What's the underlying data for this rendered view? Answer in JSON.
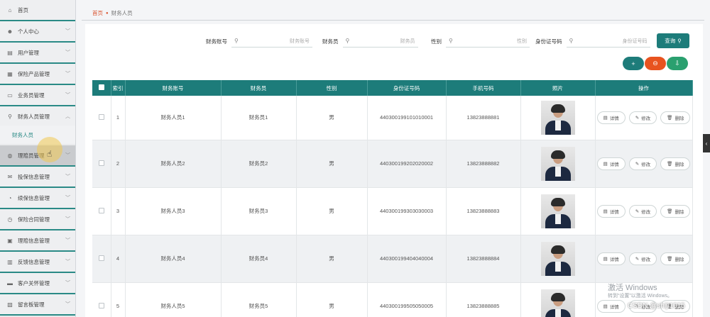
{
  "sidebar": {
    "items": [
      {
        "label": "首页",
        "icon": "home-icon",
        "glyph": "⌂",
        "chevron": false
      },
      {
        "label": "个人中心",
        "icon": "user-icon",
        "glyph": "☻",
        "chevron": true
      },
      {
        "label": "用户管理",
        "icon": "users-icon",
        "glyph": "▤",
        "chevron": true
      },
      {
        "label": "保险产品管理",
        "icon": "product-icon",
        "glyph": "▦",
        "chevron": true
      },
      {
        "label": "业务员管理",
        "icon": "folder-icon",
        "glyph": "▭",
        "chevron": true
      },
      {
        "label": "财务人员管理",
        "icon": "finance-icon",
        "glyph": "⚲",
        "chevron": true
      },
      {
        "label": "理赔员管理",
        "icon": "claims-icon",
        "glyph": "◍",
        "chevron": true
      },
      {
        "label": "投保信息管理",
        "icon": "mail-icon",
        "glyph": "✉",
        "chevron": true
      },
      {
        "label": "续保信息管理",
        "icon": "renew-icon",
        "glyph": "◔",
        "chevron": true
      },
      {
        "label": "保险合同管理",
        "icon": "contract-icon",
        "glyph": "◷",
        "chevron": true
      },
      {
        "label": "理赔信息管理",
        "icon": "claim-info-icon",
        "glyph": "▣",
        "chevron": true
      },
      {
        "label": "反馈信息管理",
        "icon": "feedback-icon",
        "glyph": "▥",
        "chevron": true
      },
      {
        "label": "客户关怀管理",
        "icon": "care-icon",
        "glyph": "▬",
        "chevron": true
      },
      {
        "label": "留言板管理",
        "icon": "message-icon",
        "glyph": "▧",
        "chevron": true
      }
    ],
    "sub_item": "财务人员"
  },
  "breadcrumb": {
    "home": "首页",
    "current": "财务人员"
  },
  "search": {
    "fields": [
      {
        "label": "财务账号",
        "placeholder": "财务账号"
      },
      {
        "label": "财务员",
        "placeholder": "财务员"
      },
      {
        "label": "性别",
        "placeholder": "性别"
      },
      {
        "label": "身份证号码",
        "placeholder": "身份证号码"
      }
    ],
    "query_label": "查询"
  },
  "actions": {
    "add": "+",
    "delete": "⊖",
    "export": "⇩"
  },
  "table": {
    "headers": [
      "索引",
      "财务账号",
      "财务员",
      "性别",
      "身份证号码",
      "手机号码",
      "照片",
      "操作"
    ],
    "rows": [
      {
        "index": "1",
        "account": "财务人员1",
        "name": "财务员1",
        "gender": "男",
        "id_card": "440300199101010001",
        "phone": "13823888881"
      },
      {
        "index": "2",
        "account": "财务人员2",
        "name": "财务员2",
        "gender": "男",
        "id_card": "440300199202020002",
        "phone": "13823888882"
      },
      {
        "index": "3",
        "account": "财务人员3",
        "name": "财务员3",
        "gender": "男",
        "id_card": "440300199303030003",
        "phone": "13823888883"
      },
      {
        "index": "4",
        "account": "财务人员4",
        "name": "财务员4",
        "gender": "男",
        "id_card": "440300199404040004",
        "phone": "13823888884"
      },
      {
        "index": "5",
        "account": "财务人员5",
        "name": "财务员5",
        "gender": "男",
        "id_card": "440300199505050005",
        "phone": "13823888885"
      }
    ],
    "ops": {
      "detail": "详情",
      "edit": "修改",
      "delete": "删除"
    }
  },
  "watermark": {
    "line1": "激活 Windows",
    "line2": "转到“设置”以激活 Windows。",
    "csdn": "CSDN @shiji1015"
  },
  "colors": {
    "primary": "#1d7c7a",
    "accent": "#e8531f",
    "add": "#1d7c7a",
    "export": "#2aa06f"
  }
}
